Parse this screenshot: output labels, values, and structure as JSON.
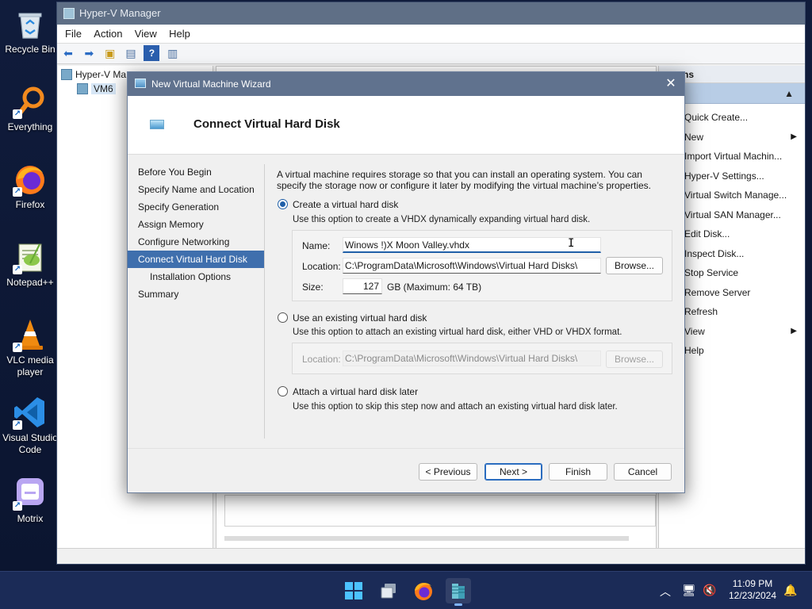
{
  "desktop": {
    "icons": [
      {
        "label": "Recycle Bin",
        "icon": "recycle-bin-icon"
      },
      {
        "label": "Everything",
        "icon": "search-magnifier-icon"
      },
      {
        "label": "Firefox",
        "icon": "firefox-icon"
      },
      {
        "label": "Notepad++",
        "icon": "notepadpp-icon"
      },
      {
        "label": "VLC media player",
        "icon": "vlc-cone-icon"
      },
      {
        "label": "Visual Studio Code",
        "icon": "vscode-icon"
      },
      {
        "label": "Motrix",
        "icon": "motrix-icon"
      }
    ]
  },
  "hyperv": {
    "title": "Hyper-V Manager",
    "menu": [
      "File",
      "Action",
      "View",
      "Help"
    ],
    "tree": {
      "root": "Hyper-V Ma",
      "child": "VM6"
    },
    "actions": {
      "header": "ns",
      "items": [
        {
          "label": "Quick Create...",
          "submenu": false
        },
        {
          "label": "New",
          "submenu": true
        },
        {
          "label": "Import Virtual Machin...",
          "submenu": false
        },
        {
          "label": "Hyper-V Settings...",
          "submenu": false
        },
        {
          "label": "Virtual Switch Manage...",
          "submenu": false
        },
        {
          "label": "Virtual SAN Manager...",
          "submenu": false
        },
        {
          "label": "Edit Disk...",
          "submenu": false
        },
        {
          "label": "Inspect Disk...",
          "submenu": false
        },
        {
          "label": "Stop Service",
          "submenu": false
        },
        {
          "label": "Remove Server",
          "submenu": false
        },
        {
          "label": "Refresh",
          "submenu": false
        },
        {
          "label": "View",
          "submenu": true
        },
        {
          "label": "Help",
          "submenu": false
        }
      ]
    }
  },
  "wizard": {
    "title": "New Virtual Machine Wizard",
    "close_glyph": "✕",
    "page_title": "Connect Virtual Hard Disk",
    "nav": [
      {
        "label": "Before You Begin",
        "selected": false,
        "indent": false
      },
      {
        "label": "Specify Name and Location",
        "selected": false,
        "indent": false
      },
      {
        "label": "Specify Generation",
        "selected": false,
        "indent": false
      },
      {
        "label": "Assign Memory",
        "selected": false,
        "indent": false
      },
      {
        "label": "Configure Networking",
        "selected": false,
        "indent": false
      },
      {
        "label": "Connect Virtual Hard Disk",
        "selected": true,
        "indent": false
      },
      {
        "label": "Installation Options",
        "selected": false,
        "indent": true
      },
      {
        "label": "Summary",
        "selected": false,
        "indent": false
      }
    ],
    "intro": "A virtual machine requires storage so that you can install an operating system. You can specify the storage now or configure it later by modifying the virtual machine’s properties.",
    "option_create": {
      "label": "Create a virtual hard disk",
      "hint": "Use this option to create a VHDX dynamically expanding virtual hard disk.",
      "checked": true,
      "name_label": "Name:",
      "name_value": "Winows !)X Moon Valley.vhdx",
      "location_label": "Location:",
      "location_value": "C:\\ProgramData\\Microsoft\\Windows\\Virtual Hard Disks\\",
      "browse_label": "Browse...",
      "size_label": "Size:",
      "size_value": "127",
      "size_unit": "GB (Maximum: 64 TB)"
    },
    "option_existing": {
      "label": "Use an existing virtual hard disk",
      "hint": "Use this option to attach an existing virtual hard disk, either VHD or VHDX format.",
      "checked": false,
      "location_label": "Location:",
      "location_value": "C:\\ProgramData\\Microsoft\\Windows\\Virtual Hard Disks\\",
      "browse_label": "Browse..."
    },
    "option_later": {
      "label": "Attach a virtual hard disk later",
      "hint": "Use this option to skip this step now and attach an existing virtual hard disk later.",
      "checked": false
    },
    "buttons": {
      "previous": "< Previous",
      "next": "Next >",
      "finish": "Finish",
      "cancel": "Cancel"
    }
  },
  "taskbar": {
    "apps": [
      "windows-start-icon",
      "task-view-icon",
      "firefox-icon",
      "hyperv-manager-icon"
    ],
    "time": "11:09 PM",
    "date": "12/23/2024"
  }
}
